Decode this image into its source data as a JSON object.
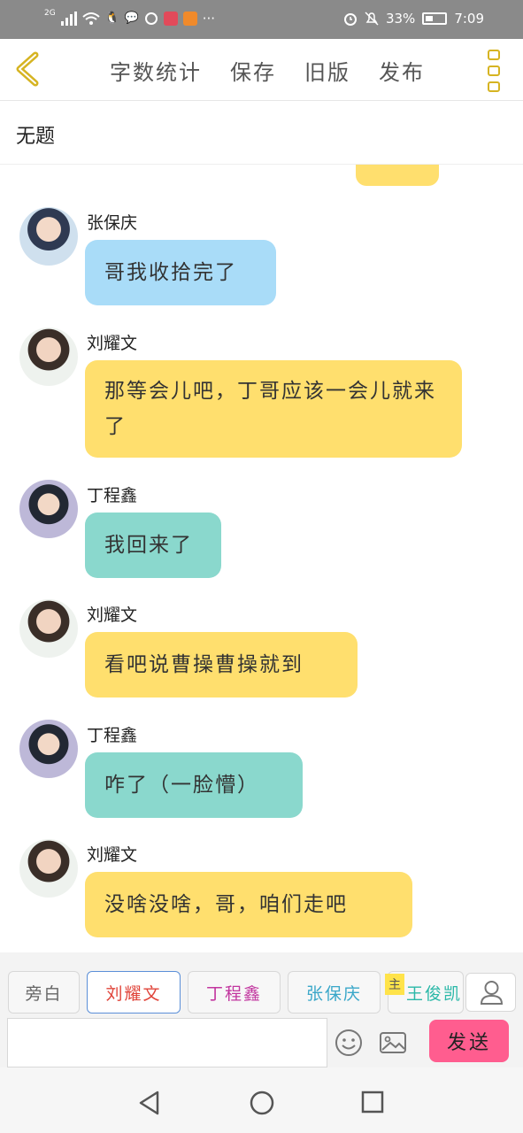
{
  "status_bar": {
    "network": "2G",
    "battery_percent": "33%",
    "time": "7:09",
    "more_dots": "···"
  },
  "toolbar": {
    "word_count": "字数统计",
    "save": "保存",
    "old_version": "旧版",
    "publish": "发布"
  },
  "document": {
    "title": "无题"
  },
  "messages": [
    {
      "sender": "张保庆",
      "text": "哥我收拾完了",
      "color": "#a9dcf8"
    },
    {
      "sender": "刘耀文",
      "text": "那等会儿吧，丁哥应该一会儿就来了",
      "color": "#ffdf6e"
    },
    {
      "sender": "丁程鑫",
      "text": "我回来了",
      "color": "#8ad8cd"
    },
    {
      "sender": "刘耀文",
      "text": "看吧说曹操曹操就到",
      "color": "#ffdf6e"
    },
    {
      "sender": "丁程鑫",
      "text": "咋了（一脸懵）",
      "color": "#8ad8cd"
    },
    {
      "sender": "刘耀文",
      "text": "没啥没啥，哥，咱们走吧",
      "color": "#ffdf6e"
    }
  ],
  "roles": [
    {
      "label": "旁白",
      "color": "#666666"
    },
    {
      "label": "刘耀文",
      "color": "#e0443a"
    },
    {
      "label": "丁程鑫",
      "color": "#c2369f"
    },
    {
      "label": "张保庆",
      "color": "#3aa7c9"
    },
    {
      "label": "王俊凯",
      "color": "#2bb8a8"
    }
  ],
  "main_role_tag": "主",
  "composer": {
    "input_value": "",
    "send_label": "发送"
  },
  "colors": {
    "accent": "#d6b422",
    "send": "#ff5d8f",
    "active_role_border": "#5b8fd8"
  }
}
